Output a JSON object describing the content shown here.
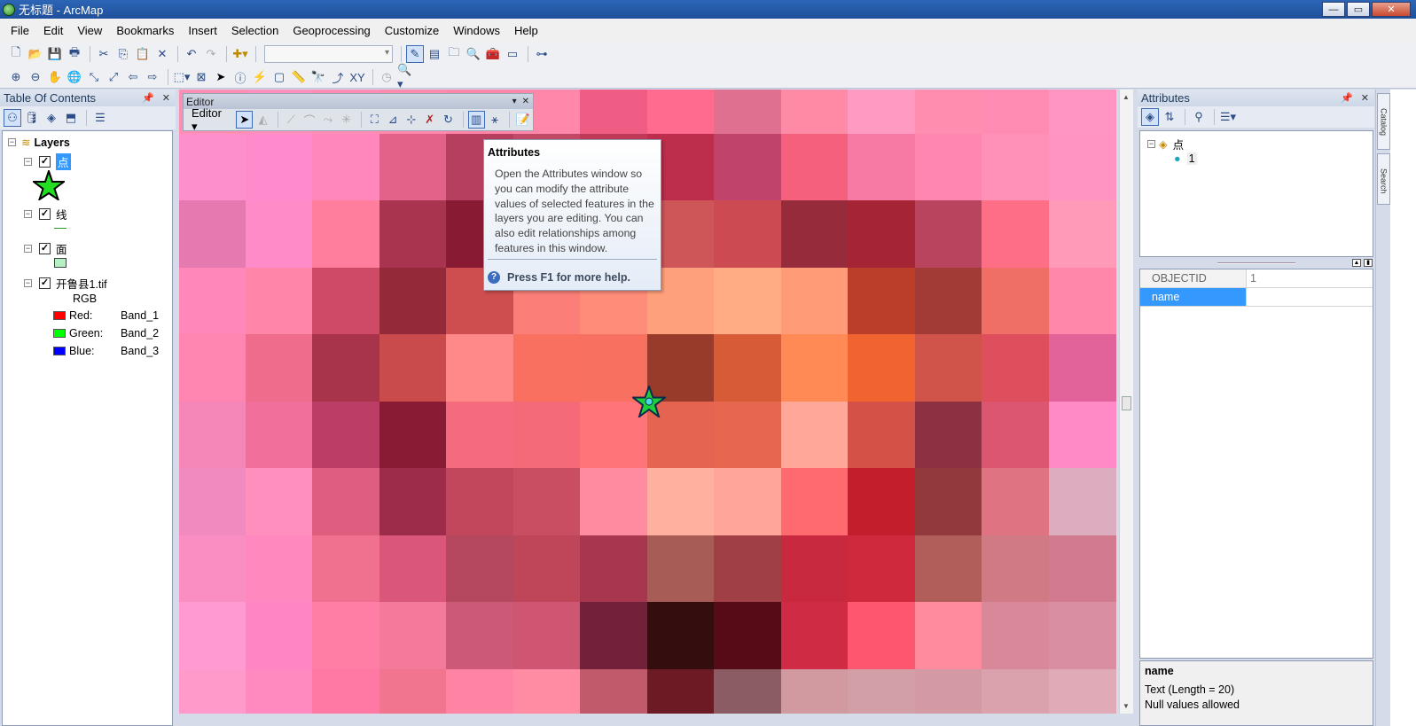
{
  "window": {
    "title": "无标题 - ArcMap",
    "minimize": "—",
    "maximize": "▭",
    "close": "✕"
  },
  "menu": [
    "File",
    "Edit",
    "View",
    "Bookmarks",
    "Insert",
    "Selection",
    "Geoprocessing",
    "Customize",
    "Windows",
    "Help"
  ],
  "toc": {
    "title": "Table Of Contents",
    "root": "Layers",
    "layers": [
      {
        "name": "点",
        "checked": true,
        "symbol": "green-star"
      },
      {
        "name": "线",
        "checked": true,
        "symbol": "green-line"
      },
      {
        "name": "面",
        "checked": true,
        "symbol": "green-fill"
      },
      {
        "name": "开鲁县1.tif",
        "checked": true,
        "symbol": "rgb"
      }
    ],
    "rgb": {
      "label": "RGB",
      "bands": [
        {
          "channel": "Red:",
          "band": "Band_1",
          "color": "#ff0000"
        },
        {
          "channel": "Green:",
          "band": "Band_2",
          "color": "#00ff00"
        },
        {
          "channel": "Blue:",
          "band": "Band_3",
          "color": "#0000ff"
        }
      ]
    }
  },
  "editor": {
    "title": "Editor",
    "menu_label": "Editor ▾"
  },
  "tooltip": {
    "title": "Attributes",
    "body": "Open the Attributes window so you can modify the attribute values of selected features in the layers you are editing. You can also edit relationships among features in this window.",
    "help": "Press F1 for more help."
  },
  "attributes": {
    "title": "Attributes",
    "tree_layer": "点",
    "tree_feature": "1",
    "fields": [
      {
        "name": "OBJECTID",
        "value": "1",
        "selected": false
      },
      {
        "name": "name",
        "value": "",
        "selected": true
      }
    ],
    "info": {
      "field": "name",
      "type": "Text (Length = 20)",
      "nulls": "Null values allowed"
    }
  },
  "dock_tabs": [
    "Catalog",
    "Search"
  ],
  "colors": {
    "raster": [
      [
        "#ff8fb2",
        "#ff90bb",
        "#ff8db5",
        "#ff8aad",
        "#ff85a8",
        "#ff87aa",
        "#f05d84",
        "#ff6b8e",
        "#e0708f",
        "#ff8aa5",
        "#ff9bc2",
        "#ff8db0",
        "#ff8cb2",
        "#ff95c0"
      ],
      [
        "#fe8fcd",
        "#ff8bcc",
        "#ff87bb",
        "#e2628a",
        "#b63e5e",
        "#c24a67",
        "#c03a57",
        "#bc2e4b",
        "#c0436c",
        "#f5607d",
        "#f77aa4",
        "#ff86b0",
        "#ff91b8",
        "#ff94c2"
      ],
      [
        "#e57ab0",
        "#ff8cc8",
        "#ff7e9d",
        "#a93450",
        "#881a33",
        "#aa3a4f",
        "#b94355",
        "#ce5659",
        "#cc4a52",
        "#962b3c",
        "#a52534",
        "#b8455d",
        "#ff6e87",
        "#ff9ab8"
      ],
      [
        "#ff88b8",
        "#ff86a8",
        "#ce4a66",
        "#942939",
        "#ce4d4e",
        "#fb7e78",
        "#ff8b79",
        "#ffa07c",
        "#ffac84",
        "#ff9b77",
        "#bb3e28",
        "#a23a35",
        "#ef6e66",
        "#ff88aa"
      ],
      [
        "#ff86b0",
        "#ef6c8d",
        "#a8344c",
        "#ca4b4b",
        "#ff8888",
        "#f97060",
        "#f77060",
        "#993b2a",
        "#d85b38",
        "#ff8a55",
        "#f2642f",
        "#d1544a",
        "#df4e5c",
        "#e2629a"
      ],
      [
        "#f587b8",
        "#f06f9b",
        "#bc3e66",
        "#891c34",
        "#f56b7e",
        "#f56a79",
        "#ff7479",
        "#e46451",
        "#e66650",
        "#ffa899",
        "#d45147",
        "#8d3142",
        "#dc5571",
        "#ff8ac6"
      ],
      [
        "#f08abf",
        "#ff8fbc",
        "#df5e7f",
        "#9c2c4a",
        "#c2475d",
        "#c94e62",
        "#ff8ba0",
        "#ffb1a0",
        "#ffa59a",
        "#ff6a6e",
        "#c21e2c",
        "#91393b",
        "#df7381",
        "#dbadbe"
      ],
      [
        "#fa8ec2",
        "#ff89bf",
        "#f07090",
        "#db577a",
        "#b5475e",
        "#bf4659",
        "#a8364f",
        "#a75d55",
        "#a03f45",
        "#c8293f",
        "#cf293e",
        "#b15e5a",
        "#cf7a84",
        "#d27b8f"
      ],
      [
        "#ff9ad3",
        "#ff85c4",
        "#ff7ea6",
        "#f47a9b",
        "#cc5a76",
        "#cf5672",
        "#73213a",
        "#340d0f",
        "#570b16",
        "#cf2b44",
        "#ff5670",
        "#ff8b9e",
        "#d9889a",
        "#d98ea1"
      ],
      [
        "#ff9acb",
        "#ff8ac0",
        "#ff79a4",
        "#f1758f",
        "#ff83a2",
        "#ff8ca2",
        "#c15a6a",
        "#6c1a24",
        "#8b5c63",
        "#d09aa0",
        "#d19fa5",
        "#d49aa4",
        "#d9a2ad",
        "#e0abb6"
      ]
    ]
  }
}
